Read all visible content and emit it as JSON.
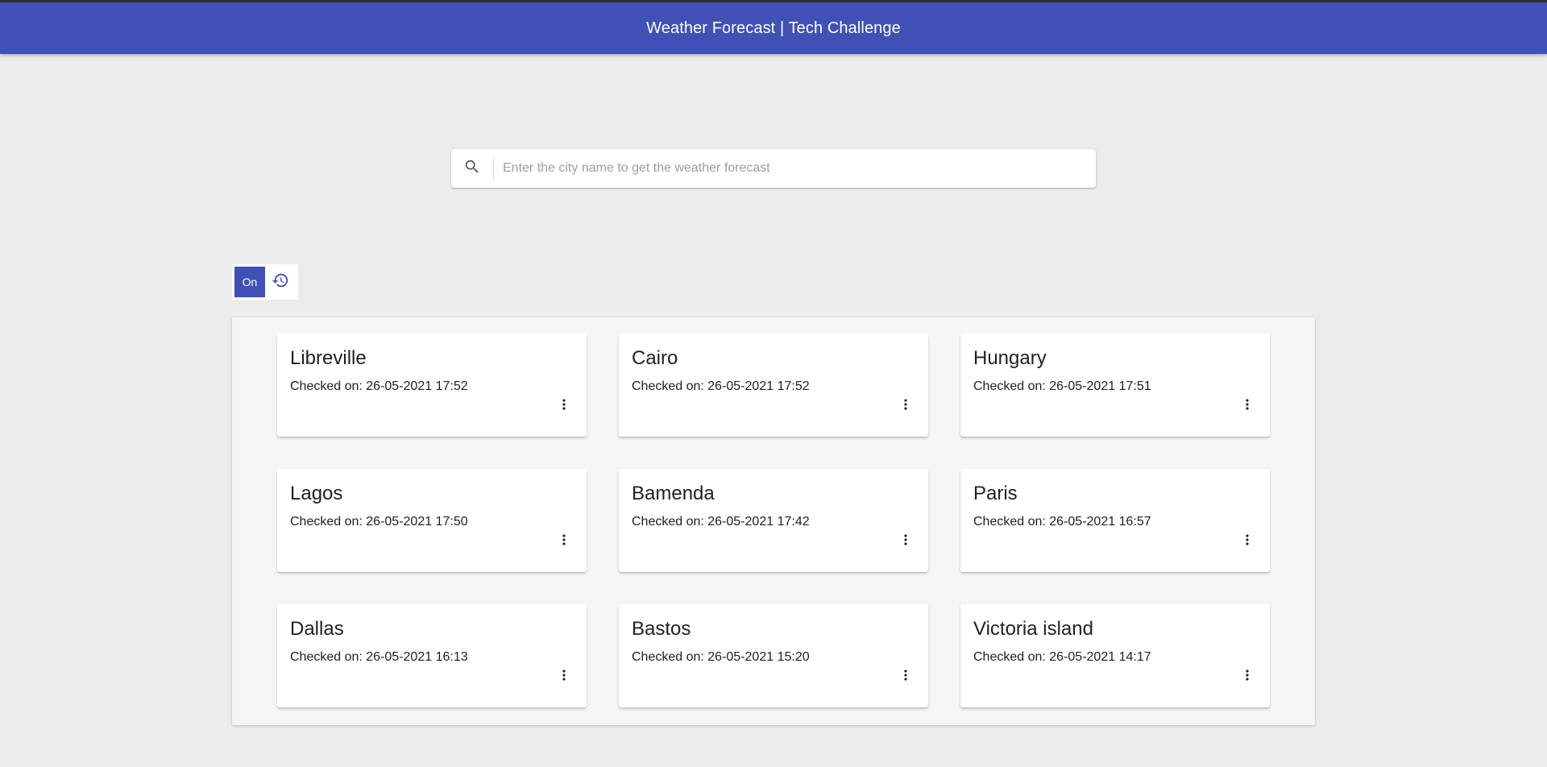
{
  "header": {
    "title": "Weather Forecast | Tech Challenge"
  },
  "search": {
    "placeholder": "Enter the city name to get the weather forecast",
    "value": "",
    "icon": "search-icon"
  },
  "toggle": {
    "on_label": "On",
    "history_icon": "history-icon"
  },
  "cities": [
    {
      "name": "Libreville",
      "checked": "Checked on: 26-05-2021 17:52"
    },
    {
      "name": "Cairo",
      "checked": "Checked on: 26-05-2021 17:52"
    },
    {
      "name": "Hungary",
      "checked": "Checked on: 26-05-2021 17:51"
    },
    {
      "name": "Lagos",
      "checked": "Checked on: 26-05-2021 17:50"
    },
    {
      "name": "Bamenda",
      "checked": "Checked on: 26-05-2021 17:42"
    },
    {
      "name": "Paris",
      "checked": "Checked on: 26-05-2021 16:57"
    },
    {
      "name": "Dallas",
      "checked": "Checked on: 26-05-2021 16:13"
    },
    {
      "name": "Bastos",
      "checked": "Checked on: 26-05-2021 15:20"
    },
    {
      "name": "Victoria island",
      "checked": "Checked on: 26-05-2021 14:17"
    }
  ],
  "colors": {
    "primary": "#3f51b5",
    "background": "#ececec",
    "panel": "#f5f5f5"
  }
}
